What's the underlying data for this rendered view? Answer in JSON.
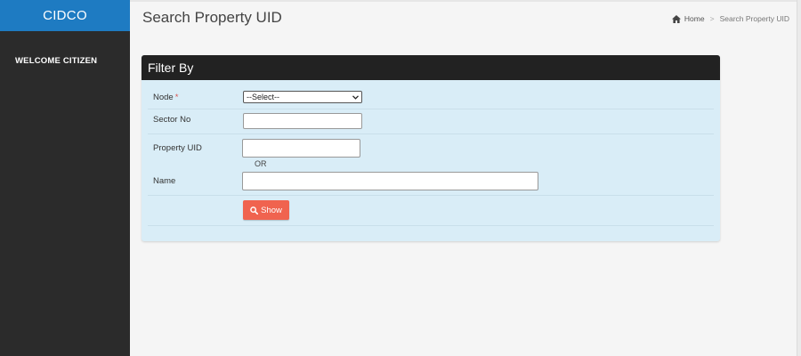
{
  "brand": "CIDCO",
  "sidebar": {
    "welcome": "WELCOME CITIZEN"
  },
  "header": {
    "title": "Search Property UID",
    "breadcrumb": {
      "home": "Home",
      "separator": ">",
      "current": "Search Property UID"
    }
  },
  "filter": {
    "heading": "Filter By",
    "node": {
      "label": "Node",
      "required_mark": "*",
      "selected": "--Select--"
    },
    "sector": {
      "label": "Sector No",
      "value": ""
    },
    "property_uid": {
      "label": "Property UID",
      "value": ""
    },
    "or_text": "OR",
    "name": {
      "label": "Name",
      "value": ""
    },
    "show_label": "Show"
  },
  "colors": {
    "brand": "#1e7bc2",
    "sidebar": "#2b2b2b",
    "panel": "#d9edf7",
    "button": "#f0634f"
  }
}
